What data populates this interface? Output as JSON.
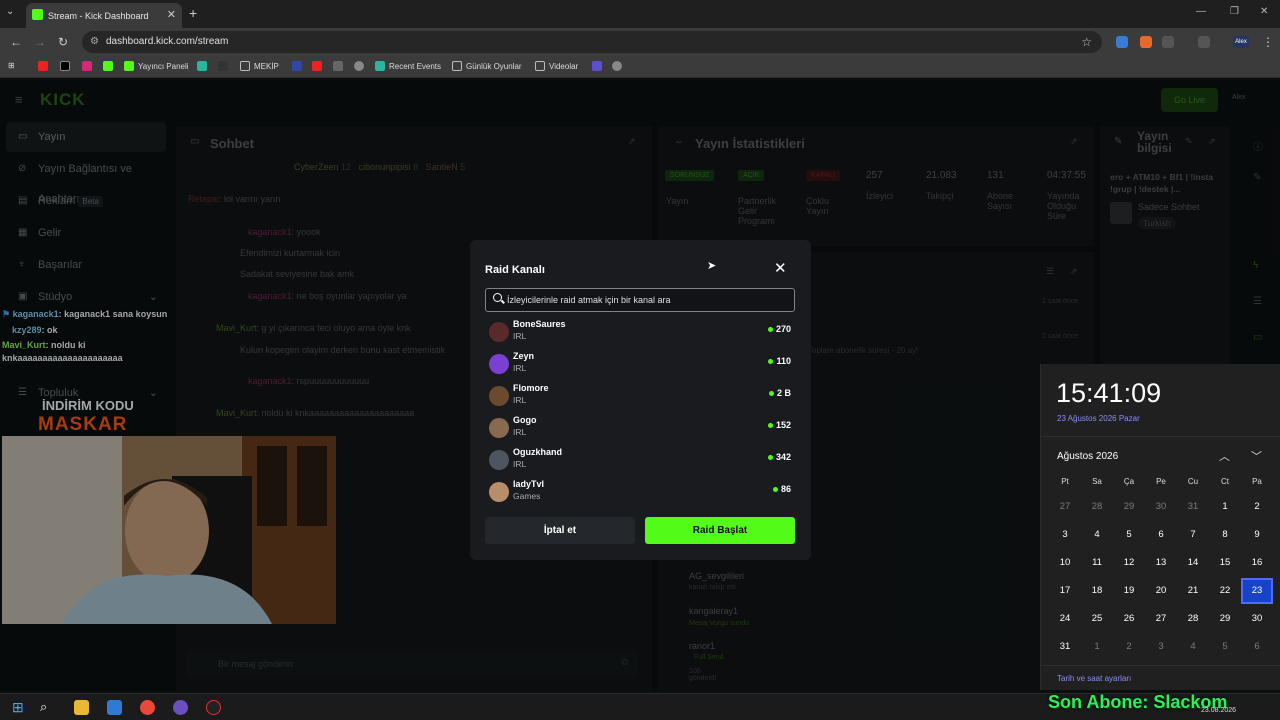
{
  "browser": {
    "tab_title": "Stream - Kick Dashboard",
    "url": "dashboard.kick.com/stream",
    "bookmarks": [
      "Yayıncı Paneli",
      "MEKİP",
      "Recent Events",
      "Günlük Oyunlar",
      "Videolar"
    ],
    "profile_label": "Alex"
  },
  "kick": {
    "logo": "KICK",
    "go_live": "Go Live",
    "sidebar": [
      {
        "label": "Yayın",
        "icon": "broadcast-icon"
      },
      {
        "label": "Yayın Bağlantısı ve Anahtarı",
        "icon": "link-icon"
      },
      {
        "label": "Reklam",
        "badge": "Beta",
        "icon": "ad-icon"
      },
      {
        "label": "Gelir",
        "icon": "money-icon"
      },
      {
        "label": "Başarılar",
        "icon": "trophy-icon"
      },
      {
        "label": "Stüdyo",
        "icon": "studio-icon"
      },
      {
        "label": "Topluluk",
        "icon": "community-icon"
      }
    ],
    "chat": {
      "title": "Sohbet",
      "top_users": [
        "CyberZeen",
        "cibonunpipisi",
        "SantieN"
      ],
      "top_counts": [
        "12",
        "8",
        "5"
      ],
      "lines": [
        {
          "user": "Retapai",
          "text": "lol varmı yarın"
        },
        {
          "user": "kaganack1",
          "text": "yoook"
        },
        {
          "user": "",
          "text": "Efendimizi kurtarmak icin"
        },
        {
          "user": "",
          "text": "Sadakat seviyesine bak amk"
        },
        {
          "user": "kaganack1",
          "text": "ne boş oyunlar yapıyolar ya"
        },
        {
          "user": "Mavi_Kurt",
          "text": "g yi çıkarınca feci oluyo ama öyle knk"
        },
        {
          "user": "",
          "text": "Kulun kopegim olayim derken bunu kast etmemistik"
        },
        {
          "user": "kaganack1",
          "text": "rspuuuuuuuuuuuu"
        },
        {
          "user": "Mavi_Kurt",
          "text": "noldu ki knkaaaaaaaaaaaaaaaaaaaaa"
        }
      ],
      "input_placeholder": "Bir mesaj gönderin"
    },
    "stats": {
      "title": "Yayın İstatistikleri",
      "badges": [
        "SORUNSUZ",
        "AÇIK",
        "KAPALI"
      ],
      "badge_labels": [
        "Yayın",
        "Partnerlik Gelir Programı",
        "Çoklu Yayın"
      ],
      "values": [
        "257",
        "21.083",
        "131",
        "04:37:55"
      ],
      "value_labels": [
        "İzleyici",
        "Takipçi",
        "Abone Sayısı",
        "Yayında Olduğu Süre"
      ]
    },
    "info": {
      "title": "Yayın bilgisi",
      "stream_title": "ero + ATM10 + Bf1 | !insta !grup | !destek |...",
      "chat_mode": "Sadece Sohbet",
      "language": "Turkish"
    },
    "activity": {
      "items": [
        {
          "user": "AG_sevgilileri",
          "text": "kanalı takip etti"
        },
        {
          "user": "kangaleray1",
          "text": "Mesaj Vurgu sundu"
        },
        {
          "user": "ranor1",
          "text": "Full Send"
        },
        {
          "user": "",
          "text": "100 gönderdi"
        }
      ],
      "times": [
        "2 saat önce",
        "2 saat önce"
      ],
      "sub_text": "Toplam abonelik süresi - 20 ay!"
    }
  },
  "overlay": {
    "chat": [
      {
        "user": "kaganack1",
        "text": ": kaganack1 sana koysun"
      },
      {
        "user": "kzy289",
        "text": ": ok"
      },
      {
        "user": "Mavi_Kurt",
        "text": ": noldu ki"
      },
      {
        "user": "",
        "text": "knkaaaaaaaaaaaaaaaaaaaaa"
      }
    ],
    "promo_line1": "İNDİRİM KODU",
    "promo_line2": "MASKAR",
    "last_sub": "Son Abone: Slackom"
  },
  "modal": {
    "title": "Raid Kanalı",
    "search_placeholder": "İzleyicilerinle raid atmak için bir kanal ara",
    "channels": [
      {
        "name": "BoneSaures",
        "category": "IRL",
        "viewers": "270",
        "avatar_color": "#c0392b"
      },
      {
        "name": "Zeyn",
        "category": "IRL",
        "viewers": "110",
        "avatar_color": "#7b3fd1"
      },
      {
        "name": "Flomore",
        "category": "IRL",
        "viewers": "2 B",
        "avatar_color": "#6b4a2e"
      },
      {
        "name": "Gogo",
        "category": "IRL",
        "viewers": "152",
        "avatar_color": "#8a6a4e"
      },
      {
        "name": "Oguzkhand",
        "category": "IRL",
        "viewers": "342",
        "avatar_color": "#4d5560"
      },
      {
        "name": "ladyTvl",
        "category": "Games",
        "viewers": "86",
        "avatar_color": "#b98d6a"
      }
    ],
    "cancel_label": "İptal et",
    "raid_label": "Raid Başlat"
  },
  "calendar": {
    "time": "15:41:09",
    "date_long": "23 Ağustos 2026 Pazar",
    "month": "Ağustos 2026",
    "weekdays": [
      "Pt",
      "Sa",
      "Ça",
      "Pe",
      "Cu",
      "Ct",
      "Pa"
    ],
    "days": [
      "27",
      "28",
      "29",
      "30",
      "31",
      "1",
      "2",
      "3",
      "4",
      "5",
      "6",
      "7",
      "8",
      "9",
      "10",
      "11",
      "12",
      "13",
      "14",
      "15",
      "16",
      "17",
      "18",
      "19",
      "20",
      "21",
      "22",
      "23",
      "24",
      "25",
      "26",
      "27",
      "28",
      "29",
      "30",
      "31",
      "1",
      "2",
      "3",
      "4",
      "5",
      "6"
    ],
    "today": "23",
    "footer": "Tarih ve saat ayarları"
  },
  "taskbar": {
    "date": "23.08.2026"
  }
}
